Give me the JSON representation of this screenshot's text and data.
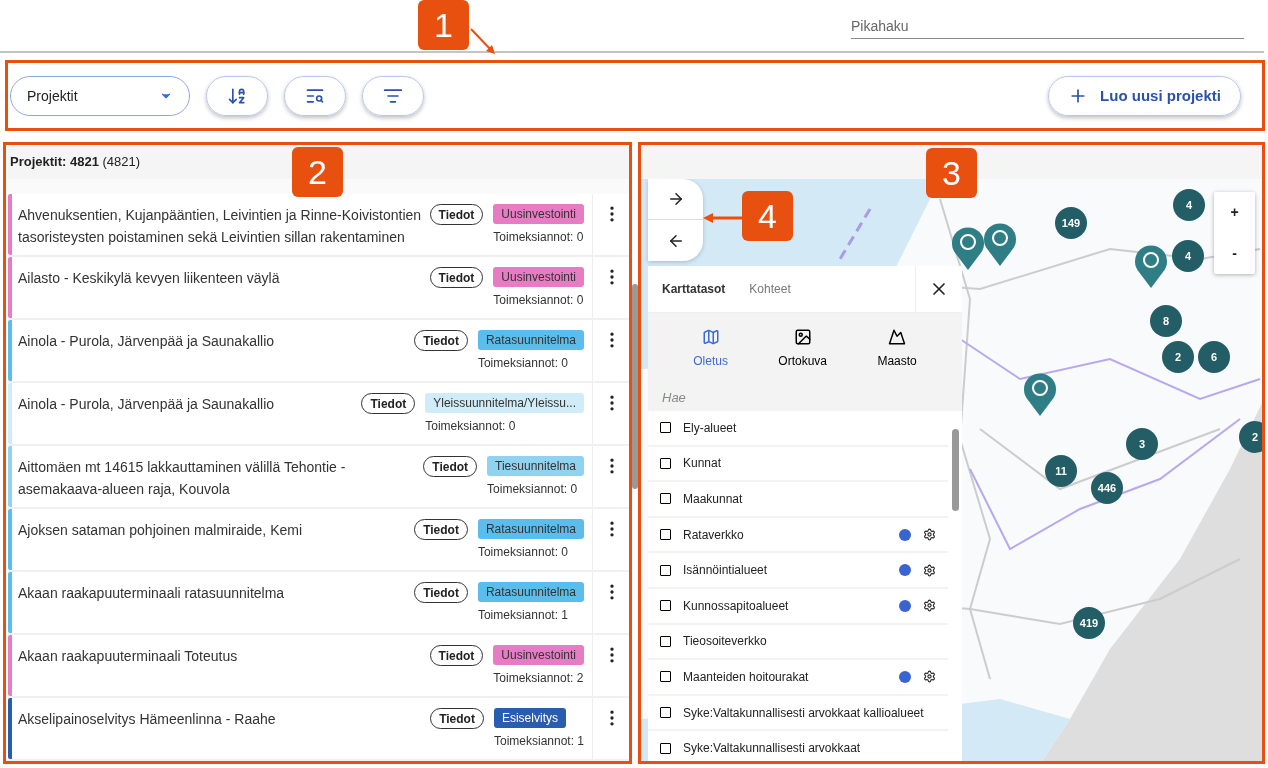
{
  "header": {
    "search": {
      "placeholder": "Pikahaku"
    }
  },
  "toolbar": {
    "select": {
      "value": "Projektit"
    },
    "icon_buttons": [
      {
        "kind": "sort"
      },
      {
        "kind": "search-list"
      },
      {
        "kind": "filter"
      }
    ],
    "create_button": {
      "label": "Luo uusi projekti"
    }
  },
  "project_list": {
    "title": "Projektit:",
    "count": "4821",
    "total": "(4821)",
    "rows": [
      {
        "name": "Ahvenuksentien, Kujanpääntien, Leivintien ja Rinne-Koivistontien tasoristeysten poistaminen sekä Leivintien sillan rakentaminen",
        "color": "#e87cc4",
        "details": "Tiedot",
        "tag": "Uusinvestointi",
        "assignments": "Toimeksiannot: 0"
      },
      {
        "name": "Ailasto - Keskikylä kevyen liikenteen väylä",
        "color": "#e87cc4",
        "details": "Tiedot",
        "tag": "Uusinvestointi",
        "assignments": "Toimeksiannot: 0"
      },
      {
        "name": "Ainola - Purola, Järvenpää ja Saunakallio",
        "color": "#5bbdec",
        "details": "Tiedot",
        "tag": "Ratasuunnitelma",
        "assignments": "Toimeksiannot: 0"
      },
      {
        "name": "Ainola - Purola, Järvenpää ja Saunakallio",
        "color": "#d0ecf9",
        "details": "Tiedot",
        "tag": "Yleissuunnitelma/Yleissu...",
        "assignments": "Toimeksiannot: 0"
      },
      {
        "name": "Aittomäen mt 14615 lakkauttaminen välillä Tehontie - asemakaava-alueen raja, Kouvola",
        "color": "#8fd3f0",
        "details": "Tiedot",
        "tag": "Tiesuunnitelma",
        "assignments": "Toimeksiannot: 0"
      },
      {
        "name": "Ajoksen sataman pohjoinen malmiraide, Kemi",
        "color": "#5bbdec",
        "details": "Tiedot",
        "tag": "Ratasuunnitelma",
        "assignments": "Toimeksiannot: 0"
      },
      {
        "name": "Akaan raakapuuterminaali ratasuunnitelma",
        "color": "#5bbdec",
        "details": "Tiedot",
        "tag": "Ratasuunnitelma",
        "assignments": "Toimeksiannot: 1"
      },
      {
        "name": "Akaan raakapuuterminaali Toteutus",
        "color": "#e87cc4",
        "details": "Tiedot",
        "tag": "Uusinvestointi",
        "assignments": "Toimeksiannot: 2"
      },
      {
        "name": "Akselipainoselvitys Hämeenlinna - Raahe",
        "color": "#2a5caf",
        "details": "Tiedot",
        "tag": "Esiselvitys",
        "assignments": "Toimeksiannot: 1"
      }
    ]
  },
  "map": {
    "nav_buttons": [
      {
        "kind": "forward"
      },
      {
        "kind": "back"
      }
    ],
    "zoom_buttons": [
      "+",
      "-"
    ],
    "clusters": [
      {
        "label": "149"
      },
      {
        "label": "4"
      },
      {
        "label": "4"
      },
      {
        "label": "8"
      },
      {
        "label": "2"
      },
      {
        "label": "6"
      },
      {
        "label": "3"
      },
      {
        "label": "11"
      },
      {
        "label": "446"
      },
      {
        "label": "419"
      },
      {
        "label": "2"
      }
    ],
    "layer_panel": {
      "tabs": [
        {
          "label": "Karttatasot",
          "selected": true
        },
        {
          "label": "Kohteet",
          "selected": false
        }
      ],
      "basemaps": [
        {
          "label": "Oletus",
          "kind": "map",
          "selected": true
        },
        {
          "label": "Ortokuva",
          "kind": "photo",
          "selected": false
        },
        {
          "label": "Maasto",
          "kind": "terrain",
          "selected": false
        }
      ],
      "search": {
        "placeholder": "Hae"
      },
      "layers": [
        {
          "label": "Ely-alueet",
          "checked": false
        },
        {
          "label": "Kunnat",
          "checked": false
        },
        {
          "label": "Maakunnat",
          "checked": false
        },
        {
          "label": "Rataverkko",
          "checked": false,
          "color": "#3a63d2"
        },
        {
          "label": "Isännöintialueet",
          "checked": false,
          "color": "#3a63d2"
        },
        {
          "label": "Kunnossapitoalueet",
          "checked": false,
          "color": "#3a63d2"
        },
        {
          "label": "Tieosoiteverkko",
          "checked": false
        },
        {
          "label": "Maanteiden hoitourakat",
          "checked": false,
          "color": "#3a63d2"
        },
        {
          "label": "Syke:Valtakunnallisesti arvokkaat kallioalueet",
          "checked": false
        },
        {
          "label": "Syke:Valtakunnallisesti arvokkaat",
          "checked": false
        }
      ]
    }
  },
  "annotations": [
    {
      "label": "1"
    },
    {
      "label": "2"
    },
    {
      "label": "3"
    },
    {
      "label": "4"
    }
  ]
}
